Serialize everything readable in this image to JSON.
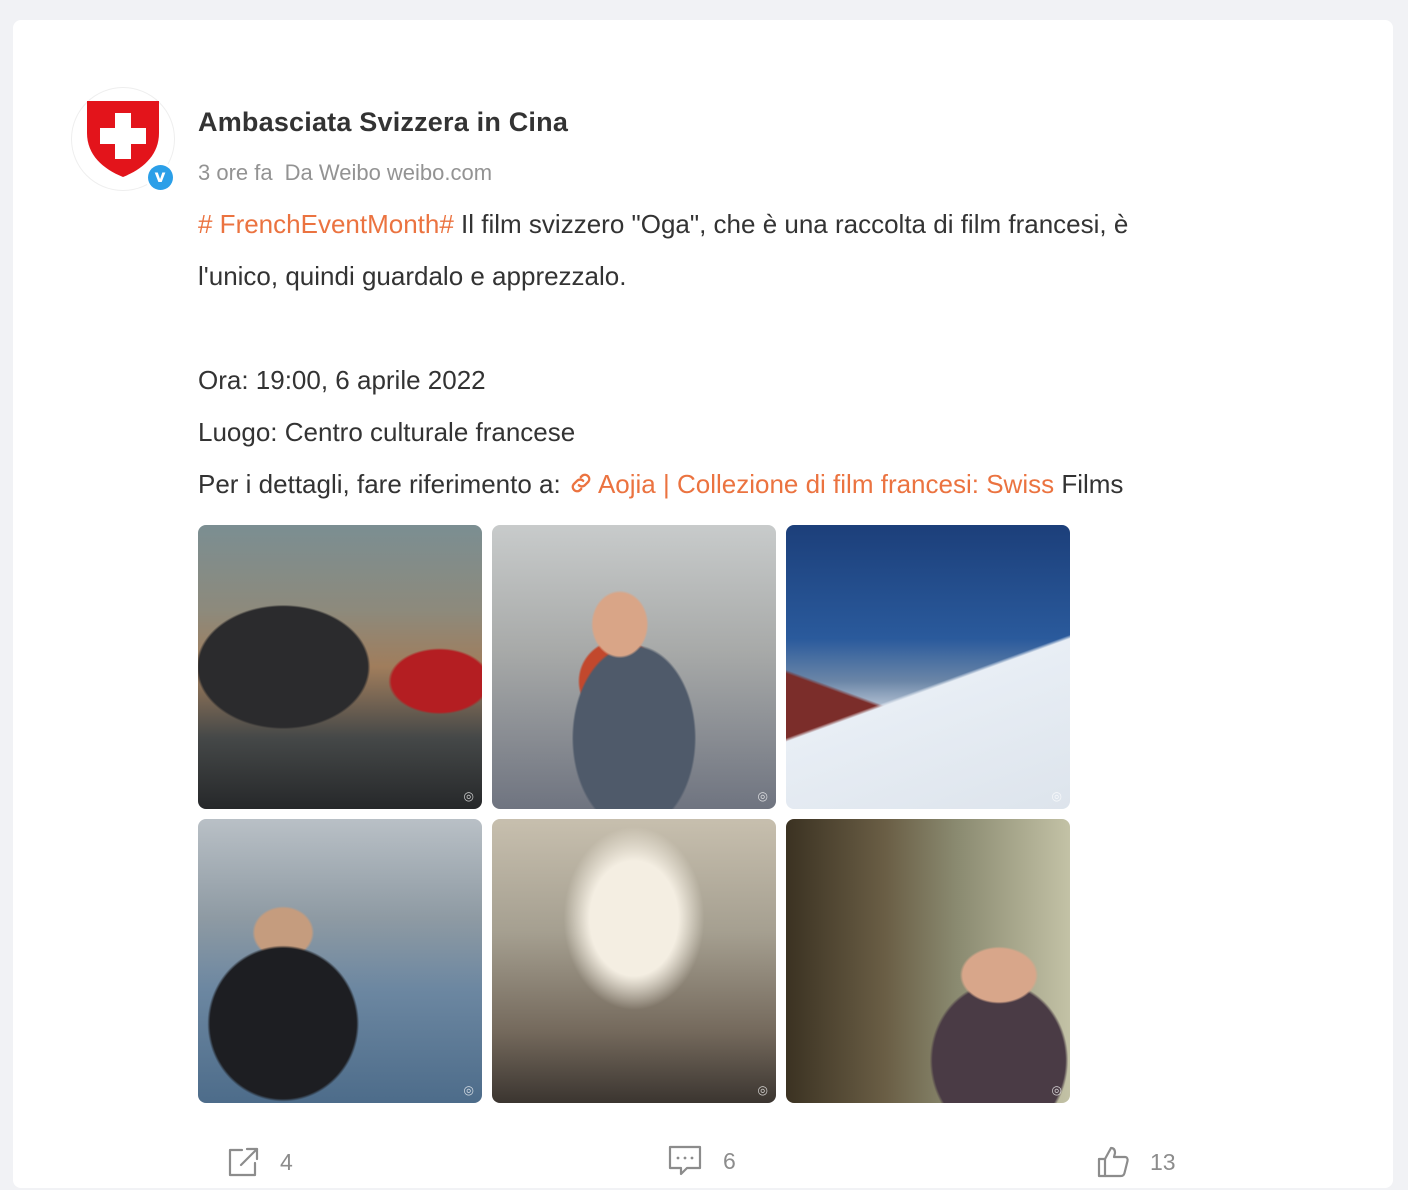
{
  "post": {
    "author": "Ambasciata Svizzera in Cina",
    "time": "3 ore fa",
    "source": "Da Weibo weibo.com",
    "hashtag": "# FrenchEventMonth#",
    "text_line1": " Il film svizzero \"Oga\", che è una raccolta di film francesi, è",
    "text_line2": "l'unico, quindi guardalo e apprezzalo.",
    "time_line": "Ora: 19:00, 6 aprile 2022",
    "place_line": "Luogo: Centro culturale francese",
    "details_prefix": "Per i dettagli, fare riferimento a: ",
    "link_text": "Aojia | Collezione di film francesi: Swiss",
    "details_suffix": " Films"
  },
  "photos": [
    {
      "name": "photo-gymnasts-talking"
    },
    {
      "name": "photo-hug"
    },
    {
      "name": "photo-snowy-track"
    },
    {
      "name": "photo-suisse-jacket"
    },
    {
      "name": "photo-uneven-bars"
    },
    {
      "name": "photo-girl-portrait"
    }
  ],
  "actions": {
    "shares": "4",
    "comments": "6",
    "likes": "13"
  },
  "colors": {
    "accent": "#eb7340",
    "verified": "#2b9fe8",
    "swiss_red": "#e3141b"
  },
  "icons": [
    "swiss-shield-icon",
    "verified-icon",
    "link-icon",
    "share-icon",
    "comment-icon",
    "like-icon"
  ]
}
